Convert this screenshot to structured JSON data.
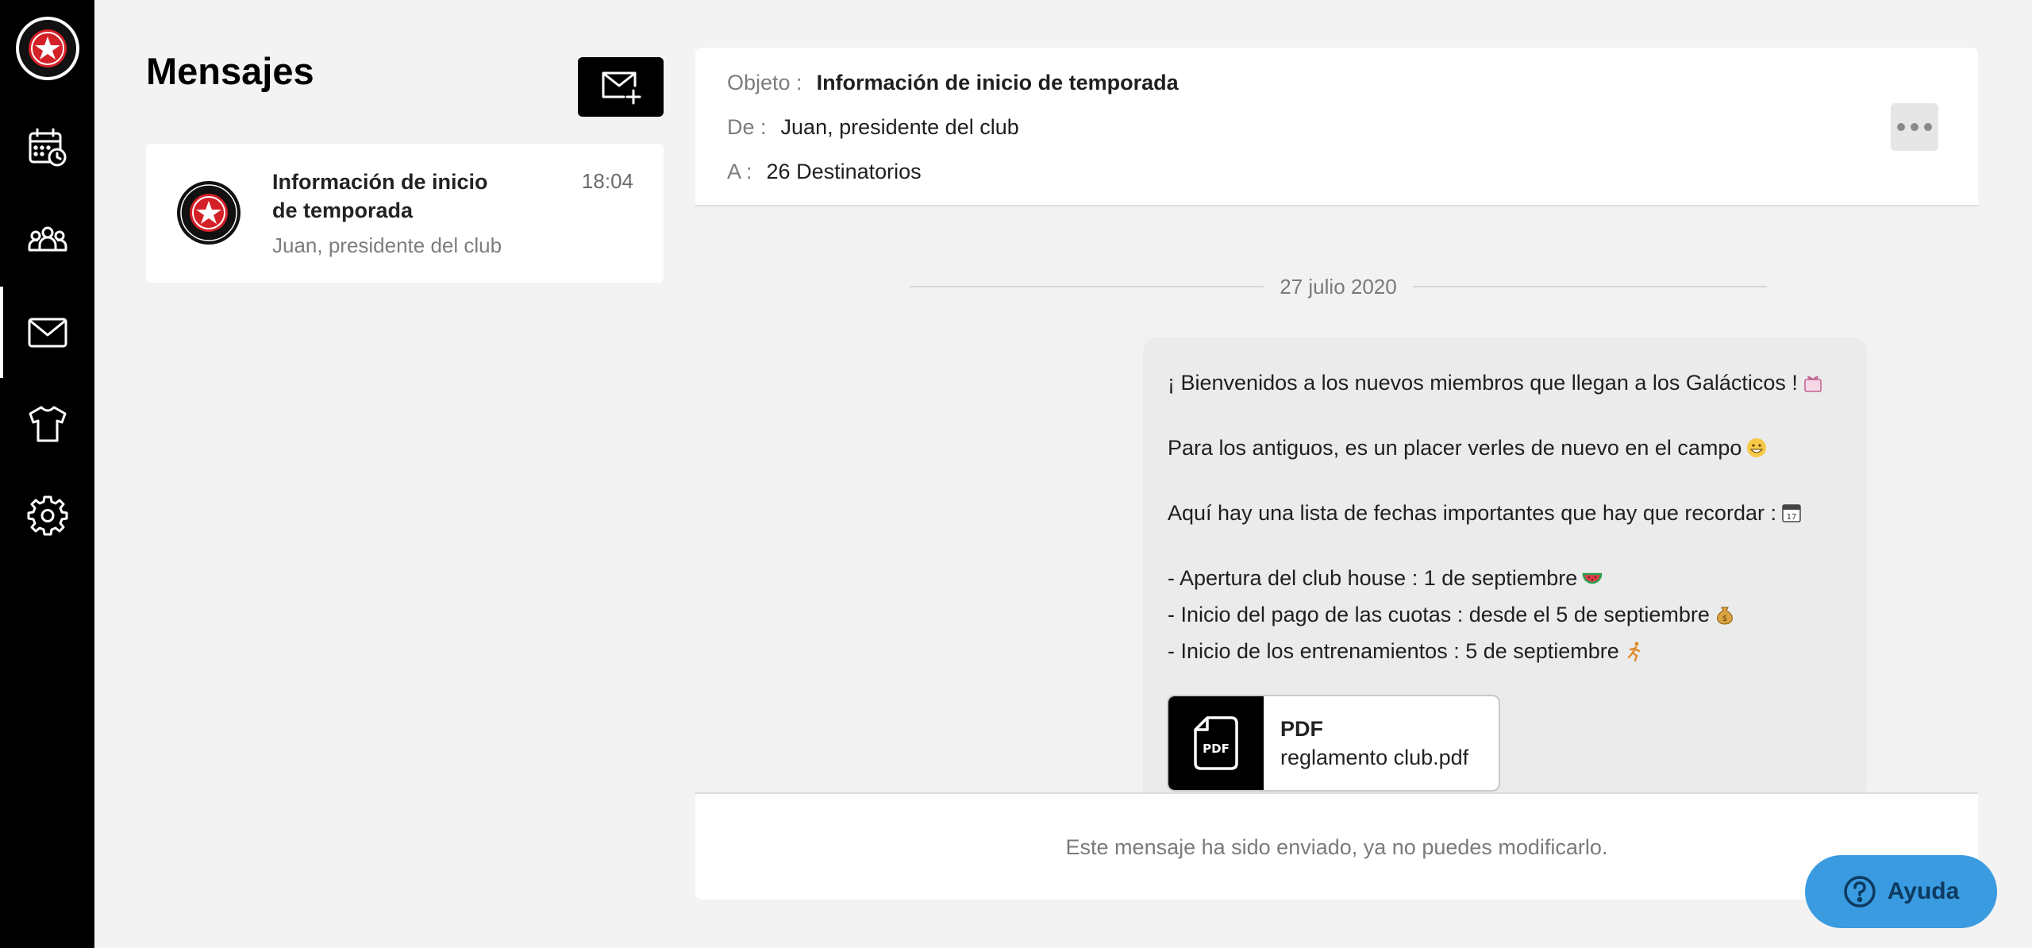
{
  "sidebar": {
    "logo_icon": "club-crest-icon",
    "items": [
      {
        "name": "calendar",
        "icon": "calendar-clock-icon"
      },
      {
        "name": "members",
        "icon": "group-icon"
      },
      {
        "name": "messages",
        "icon": "mail-icon",
        "active": true
      },
      {
        "name": "equipment",
        "icon": "shirt-icon"
      },
      {
        "name": "settings",
        "icon": "gear-icon"
      }
    ]
  },
  "messages_list": {
    "title": "Mensajes",
    "compose_icon": "mail-plus-icon",
    "items": [
      {
        "subject": "Información de inicio de temporada",
        "time": "18:04",
        "preview": "Juan, presidente del club"
      }
    ]
  },
  "message": {
    "subject_label": "Objeto :",
    "subject": "Información de inicio de temporada",
    "from_label": "De :",
    "from": "Juan, presidente del club",
    "to_label": "A :",
    "to": "26 Destinatorios",
    "date": "27 julio 2020",
    "lines": [
      "¡ Bienvenidos a los nuevos miembros que llegan a los Galácticos !",
      "Para los antiguos, es un placer verles de nuevo en el campo",
      "Aquí hay una lista de fechas importantes que hay que recordar :",
      "- Apertura del club house : 1 de septiembre",
      "- Inicio del pago de las cuotas : desde el 5 de septiembre",
      "- Inicio de los entrenamientos : 5 de septiembre"
    ],
    "attachment": {
      "type": "PDF",
      "filename": "reglamento club.pdf",
      "icon_text": "PDF"
    },
    "footer_notice": "Este mensaje ha sido enviado, ya no puedes modificarlo."
  },
  "help": {
    "label": "Ayuda"
  }
}
